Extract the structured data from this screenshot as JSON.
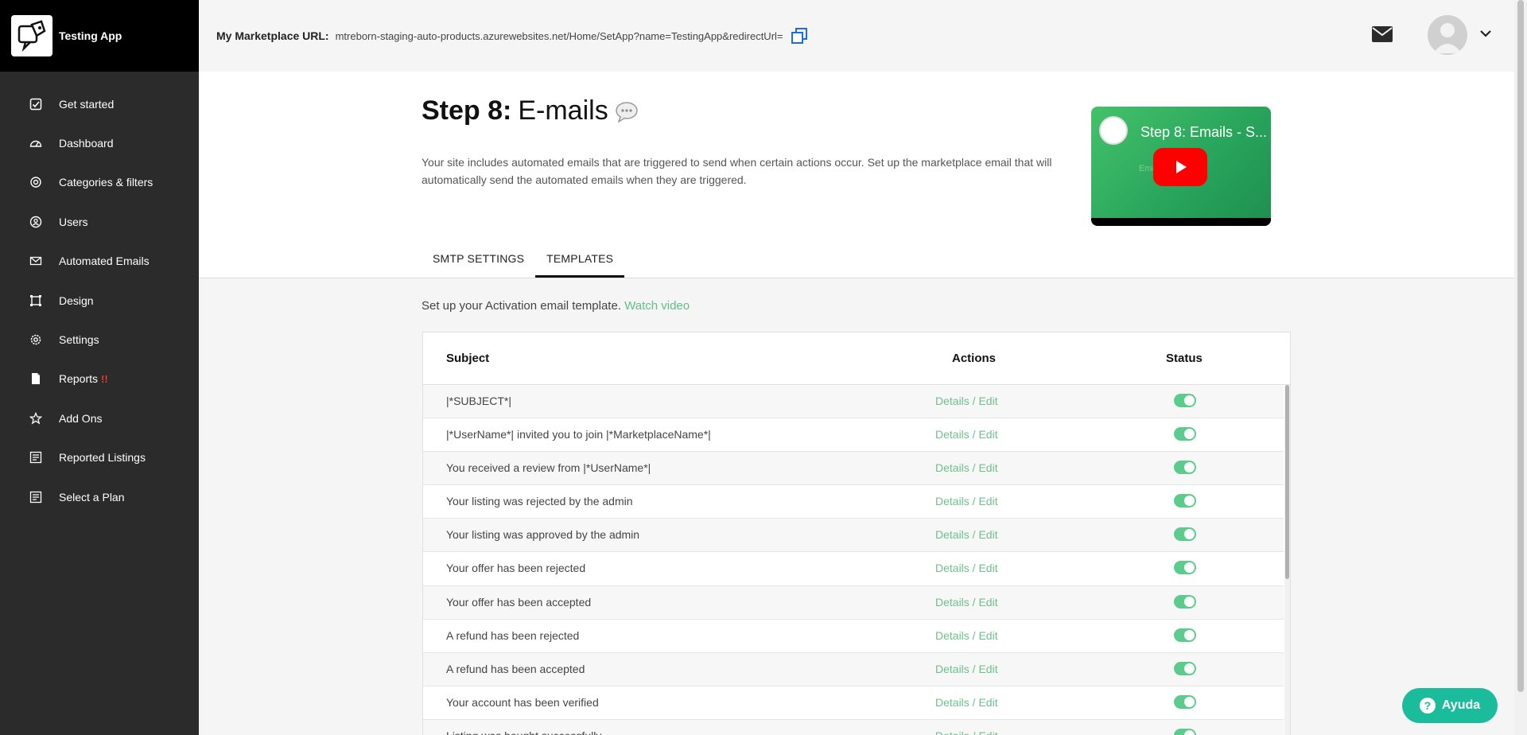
{
  "brand": {
    "name": "Testing App"
  },
  "sidebar": {
    "items": [
      {
        "label": "Get started",
        "icon": "check-square-icon"
      },
      {
        "label": "Dashboard",
        "icon": "gauge-icon"
      },
      {
        "label": "Categories & filters",
        "icon": "target-icon"
      },
      {
        "label": "Users",
        "icon": "user-circle-icon"
      },
      {
        "label": "Automated Emails",
        "icon": "envelope-icon"
      },
      {
        "label": "Design",
        "icon": "frame-icon"
      },
      {
        "label": "Settings",
        "icon": "gear-icon"
      },
      {
        "label": "Reports",
        "icon": "document-icon",
        "alert": "!!"
      },
      {
        "label": "Add Ons",
        "icon": "star-icon"
      },
      {
        "label": "Reported Listings",
        "icon": "list-icon"
      },
      {
        "label": "Select a Plan",
        "icon": "list-icon"
      }
    ]
  },
  "topbar": {
    "url_label": "My Marketplace URL:",
    "url_value": "mtreborn-staging-auto-products.azurewebsites.net/Home/SetApp?name=TestingApp&redirectUrl="
  },
  "step": {
    "prefix": "Step 8:",
    "name": "E-mails",
    "description": "Your site includes automated emails that are triggered to send when certain actions occur. Set up the marketplace email that will automatically send the automated emails when they are triggered."
  },
  "video": {
    "title": "Step 8: Emails - S...",
    "faint_text": "Email Settings"
  },
  "tabs": [
    {
      "label": "SMTP SETTINGS",
      "active": false
    },
    {
      "label": "TEMPLATES",
      "active": true
    }
  ],
  "intro": {
    "text": "Set up your Activation email template.",
    "link": "Watch video"
  },
  "table": {
    "headers": {
      "subject": "Subject",
      "actions": "Actions",
      "status": "Status"
    },
    "action_label": "Details / Edit",
    "rows": [
      {
        "subject": "|*SUBJECT*|",
        "status": true
      },
      {
        "subject": "|*UserName*| invited you to join |*MarketplaceName*|",
        "status": true
      },
      {
        "subject": "You received a review from |*UserName*|",
        "status": true
      },
      {
        "subject": "Your listing was rejected by the admin",
        "status": true
      },
      {
        "subject": "Your listing was approved by the admin",
        "status": true
      },
      {
        "subject": "Your offer has been rejected",
        "status": true
      },
      {
        "subject": "Your offer has been accepted",
        "status": true
      },
      {
        "subject": "A refund has been rejected",
        "status": true
      },
      {
        "subject": "A refund has been accepted",
        "status": true
      },
      {
        "subject": "Your account has been verified",
        "status": true
      },
      {
        "subject": "Listing was bought successfully",
        "status": true
      }
    ]
  },
  "help": {
    "label": "Ayuda"
  },
  "colors": {
    "accent_green": "#5ccc8c",
    "link_green": "#6cc08c",
    "help_teal": "#1abc9c",
    "sidebar_bg": "#2b2b2b"
  }
}
